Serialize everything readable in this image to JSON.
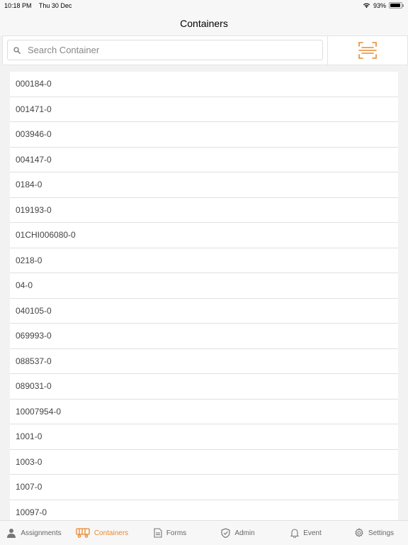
{
  "status_bar": {
    "time": "10:18 PM",
    "date": "Thu 30 Dec",
    "battery": "93%",
    "battery_level": 0.93
  },
  "nav": {
    "title": "Containers"
  },
  "search": {
    "placeholder": "Search Container",
    "value": ""
  },
  "containers": [
    "000184-0",
    "001471-0",
    "003946-0",
    "004147-0",
    "0184-0",
    "019193-0",
    "01CHI006080-0",
    "0218-0",
    "04-0",
    "040105-0",
    "069993-0",
    "088537-0",
    "089031-0",
    "10007954-0",
    "1001-0",
    "1003-0",
    "1007-0",
    "10097-0"
  ],
  "tabs": [
    {
      "label": "Assignments",
      "icon": "person-icon",
      "active": false
    },
    {
      "label": "Containers",
      "icon": "truck-icon",
      "active": true
    },
    {
      "label": "Forms",
      "icon": "document-icon",
      "active": false
    },
    {
      "label": "Admin",
      "icon": "shield-icon",
      "active": false
    },
    {
      "label": "Event",
      "icon": "bell-icon",
      "active": false
    },
    {
      "label": "Settings",
      "icon": "gear-icon",
      "active": false
    }
  ],
  "colors": {
    "accent": "#e8892f",
    "background": "#f2f2f2"
  }
}
